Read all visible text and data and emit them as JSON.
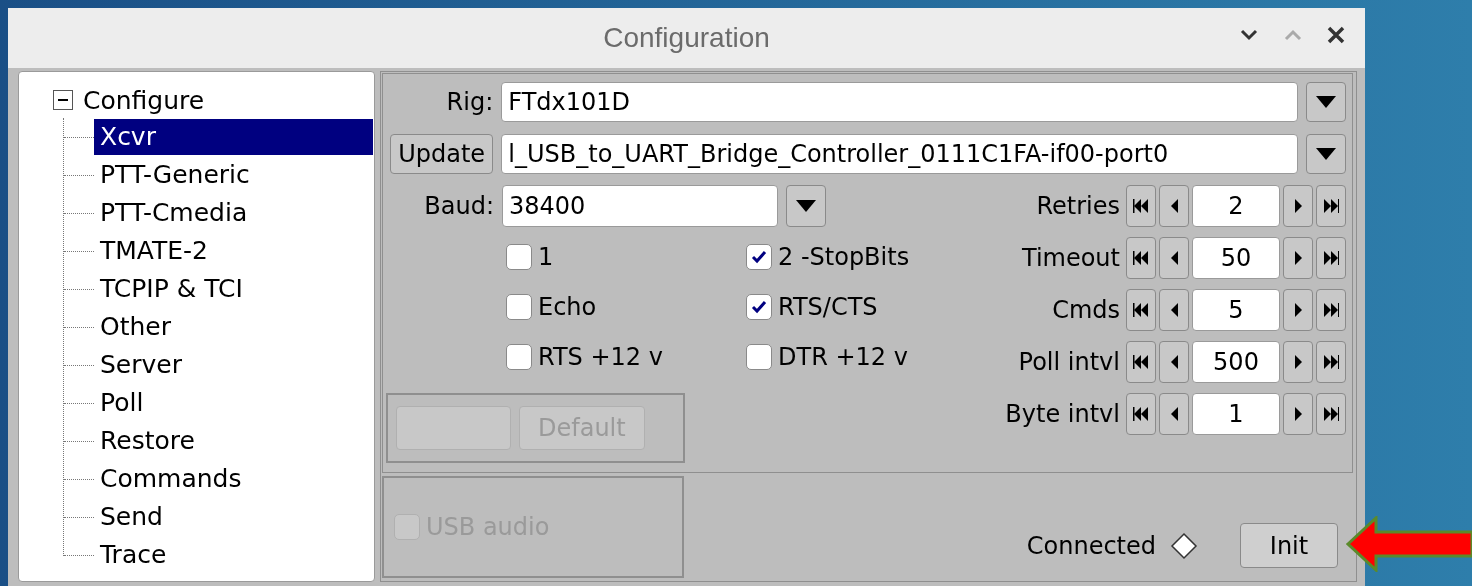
{
  "window": {
    "title": "Configuration"
  },
  "tree": {
    "label": "Configure",
    "expanded": true,
    "children": [
      {
        "label": "Xcvr",
        "selected": true
      },
      {
        "label": "PTT-Generic",
        "selected": false
      },
      {
        "label": "PTT-Cmedia",
        "selected": false
      },
      {
        "label": "TMATE-2",
        "selected": false
      },
      {
        "label": "TCPIP & TCI",
        "selected": false
      },
      {
        "label": "Other",
        "selected": false
      },
      {
        "label": "Server",
        "selected": false
      },
      {
        "label": "Poll",
        "selected": false
      },
      {
        "label": "Restore",
        "selected": false
      },
      {
        "label": "Commands",
        "selected": false
      },
      {
        "label": "Send",
        "selected": false
      },
      {
        "label": "Trace",
        "selected": false
      }
    ]
  },
  "rig": {
    "label": "Rig:",
    "value": "FTdx101D"
  },
  "port": {
    "button": "Update",
    "value": "l_USB_to_UART_Bridge_Controller_0111C1FA-if00-port0"
  },
  "baud": {
    "label": "Baud:",
    "value": "38400"
  },
  "checkboxes": [
    {
      "label": "1",
      "checked": false
    },
    {
      "label": "2 -StopBits",
      "checked": true
    },
    {
      "label": "Echo",
      "checked": false
    },
    {
      "label": "RTS/CTS",
      "checked": true
    },
    {
      "label": "RTS +12 v",
      "checked": false
    },
    {
      "label": "DTR +12 v",
      "checked": false
    }
  ],
  "spinners": [
    {
      "label": "Retries",
      "value": "2"
    },
    {
      "label": "Timeout",
      "value": "50"
    },
    {
      "label": "Cmds",
      "value": "5"
    },
    {
      "label": "Poll intvl",
      "value": "500"
    },
    {
      "label": "Byte intvl",
      "value": "1"
    }
  ],
  "group_buttons": [
    {
      "disabled": true
    },
    {
      "label": "Default",
      "disabled": true
    }
  ],
  "usb_audio": {
    "label": "USB audio",
    "checked": false,
    "disabled": true
  },
  "status": {
    "label": "Connected",
    "on": false
  },
  "init_button": "Init"
}
